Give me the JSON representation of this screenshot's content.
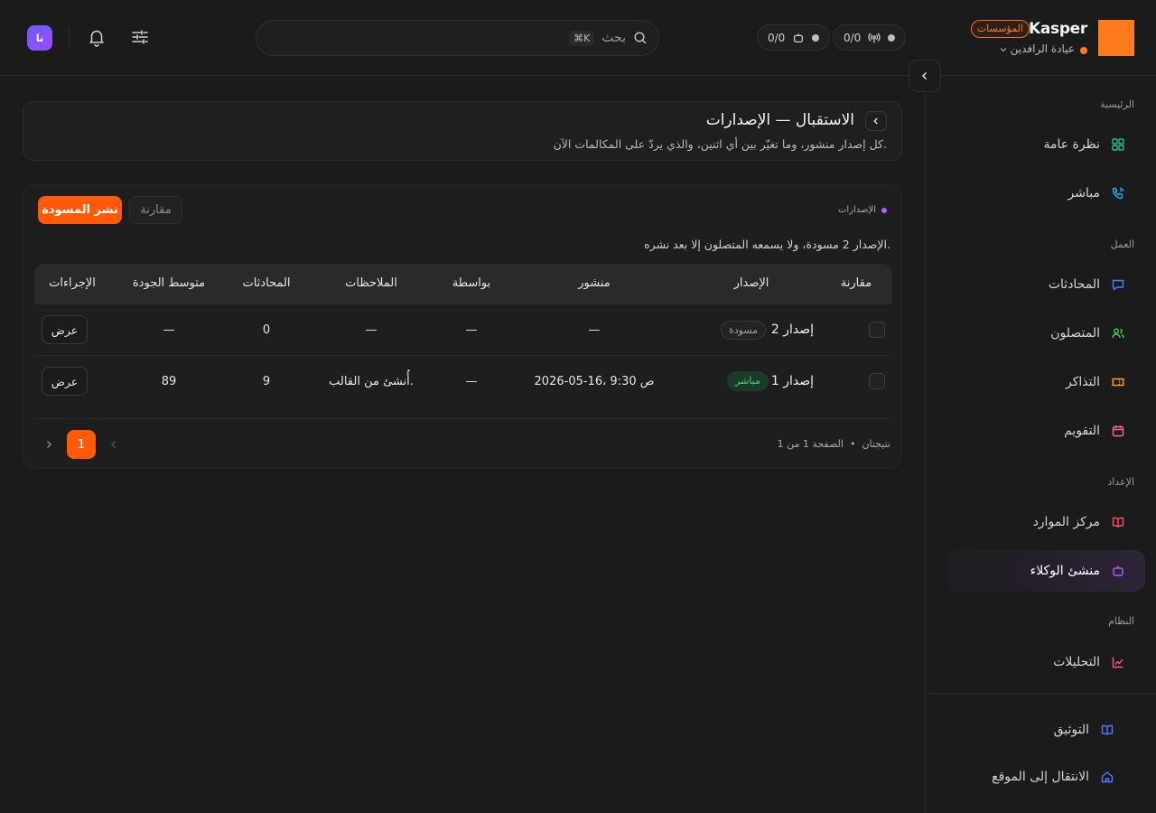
{
  "brand": {
    "name": "Kasper",
    "badge": "المؤسسات",
    "org": "عيادة الرافدين"
  },
  "status": {
    "calls": "0/0",
    "agents": "0/0"
  },
  "search": {
    "placeholder": "بحث",
    "shortcut": "⌘K"
  },
  "user": {
    "initials": "نا"
  },
  "sidebar": {
    "sections": [
      {
        "label": "الرئيسية",
        "items": [
          {
            "label": "نظرة عامة",
            "icon": "grid-icon",
            "color": "#22c08a"
          },
          {
            "label": "مباشر",
            "icon": "phone-call-icon",
            "color": "#2bb3ff"
          }
        ]
      },
      {
        "label": "العمل",
        "items": [
          {
            "label": "المحادثات",
            "icon": "message-icon",
            "color": "#4d7cff"
          },
          {
            "label": "المتصلون",
            "icon": "users-icon",
            "color": "#3ecf5a"
          },
          {
            "label": "التذاكر",
            "icon": "ticket-icon",
            "color": "#ff9a1a"
          },
          {
            "label": "التقويم",
            "icon": "calendar-icon",
            "color": "#ff5fa8"
          }
        ]
      },
      {
        "label": "الإعداد",
        "items": [
          {
            "label": "مركز الموارد",
            "icon": "book-open-icon",
            "color": "#ff4d5e"
          },
          {
            "label": "منشئ الوكلاء",
            "icon": "bot-icon",
            "color": "#b15cff",
            "active": true
          }
        ]
      },
      {
        "label": "النظام",
        "items": [
          {
            "label": "التحليلات",
            "icon": "chart-line-icon",
            "color": "#ff4fa0"
          }
        ]
      }
    ],
    "footer": [
      {
        "label": "التوثيق",
        "icon": "book-icon",
        "color": "#4d7cff"
      },
      {
        "label": "الانتقال إلى الموقع",
        "icon": "home-icon",
        "color": "#4d7cff"
      }
    ]
  },
  "page": {
    "title": "الاستقبال — الإصدارات",
    "subtitle": "كل إصدار منشور، وما تغيّر بين أي اثنين، والذي يردّ على المكالمات الآن."
  },
  "versions": {
    "section_label": "الإصدارات",
    "compare_button": "مقارنة",
    "publish_button": "نشر المسودة",
    "info": "الإصدار 2 مسودة، ولا يسمعه المتصلون إلا بعد نشره.",
    "columns": [
      "مقارنة",
      "الإصدار",
      "منشور",
      "بواسطة",
      "الملاحظات",
      "المحادثات",
      "متوسط الجودة",
      "الإجراءات"
    ],
    "rows": [
      {
        "version": "إصدار 2",
        "tag": "مسودة",
        "published": "—",
        "by": "—",
        "notes": "—",
        "conversations": "0",
        "quality": "—",
        "action": "عرض"
      },
      {
        "version": "إصدار 1",
        "tag": "مباشر",
        "published": "2026-05-16، 9:30 ص",
        "by": "—",
        "notes": "أُنشئ من القالب.",
        "conversations": "9",
        "quality": "89",
        "action": "عرض"
      }
    ],
    "pagination": {
      "results": "نتيجتان",
      "page_info": "الصفحة 1 من 1",
      "current": "1"
    }
  },
  "colors": {
    "accent": "#ff5a0a",
    "brand": "#ff7a1a",
    "live": "#4ccd7a"
  }
}
